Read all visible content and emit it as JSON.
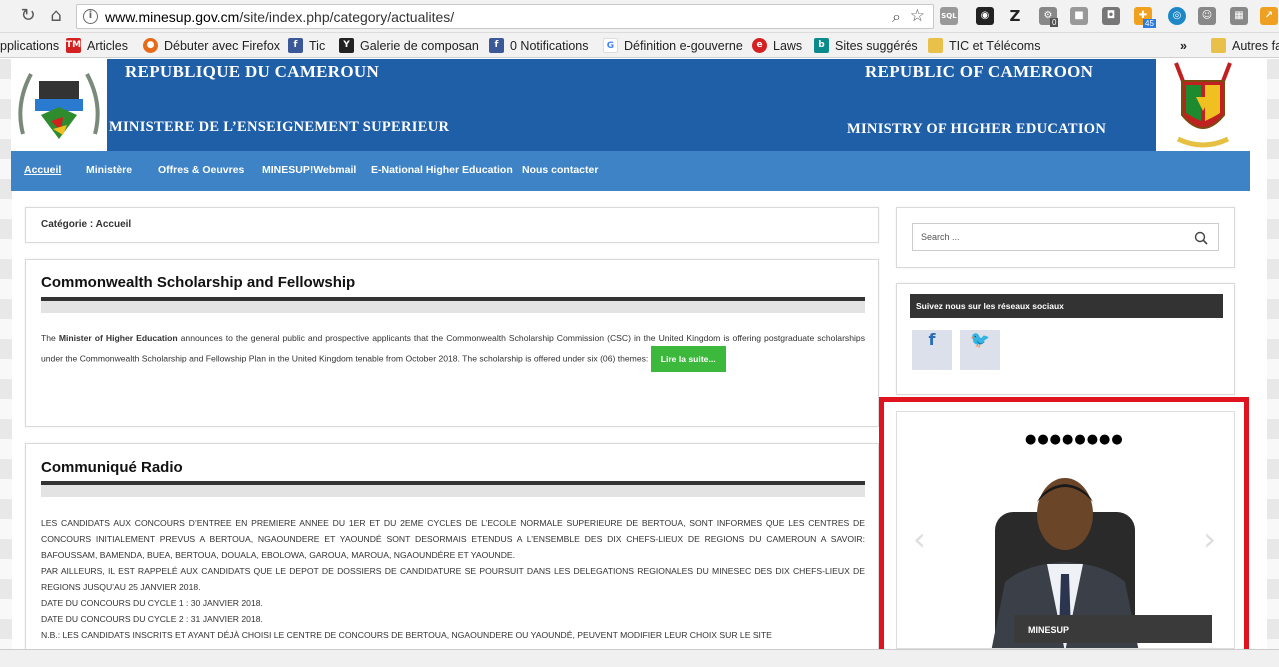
{
  "browser": {
    "url_prefix": "www.minesup.gov.cm",
    "url_path": "/site/index.php/category/actualites/",
    "bookmarks": [
      {
        "label": "pplications",
        "icon": "apps-icon",
        "color": "#4a78c2"
      },
      {
        "label": "Articles",
        "icon": "tm-icon",
        "color": "#d42020"
      },
      {
        "label": "Débuter avec Firefox",
        "icon": "firefox-icon",
        "color": "#e66a1a"
      },
      {
        "label": "Tic",
        "icon": "facebook-icon",
        "color": "#3b5998"
      },
      {
        "label": "Galerie de composan",
        "icon": "joomla-icon",
        "color": "#222"
      },
      {
        "label": "0 Notifications",
        "icon": "facebook-icon",
        "color": "#3b5998"
      },
      {
        "label": "Définition e-gouverne",
        "icon": "google-icon",
        "color": "#4285f4"
      },
      {
        "label": "Laws",
        "icon": "e-icon",
        "color": "#d42020"
      },
      {
        "label": "Sites suggérés",
        "icon": "bing-icon",
        "color": "#0a8a8a"
      },
      {
        "label": "TIC et Télécoms",
        "icon": "folder-icon",
        "color": "#e8c04a"
      },
      {
        "label": "»",
        "icon": "",
        "color": ""
      },
      {
        "label": "Autres fa",
        "icon": "folder-icon",
        "color": "#e8c04a"
      }
    ],
    "extension_badges": {
      "badge1": "0",
      "badge2": "45"
    }
  },
  "banner": {
    "fr_title": "REPUBLIQUE DU CAMEROUN",
    "fr_ministry": "MINISTERE DE L’ENSEIGNEMENT SUPERIEUR",
    "en_title": "REPUBLIC OF CAMEROON",
    "en_ministry": "MINISTRY OF HIGHER EDUCATION",
    "logo_left": "MINESUP"
  },
  "menu": [
    "Accueil",
    "Ministère",
    "Offres & Oeuvres",
    "MINESUP!Webmail",
    "E-National Higher Education",
    "Nous contacter"
  ],
  "breadcrumb": "Catégorie : Accueil",
  "posts": [
    {
      "title": "Commonwealth Scholarship and Fellowship",
      "text_pre": "The ",
      "text_bold": "Minister of Higher Education",
      "text_post": " announces to the general public and prospective applicants that the Commonwealth Scholarship Commission (CSC) in the United Kingdom is offering postgraduate scholarships under the Commonwealth Scholarship and Fellowship Plan in the United Kingdom tenable from October 2018. The scholarship is offered under six (06) themes: ",
      "read_more": "Lire la suite..."
    },
    {
      "title": "Communiqué Radio",
      "lines": [
        "LES CANDIDATS AUX CONCOURS D’ENTREE EN PREMIERE ANNEE DU 1ER ET DU 2EME CYCLES DE L’ECOLE NORMALE SUPERIEURE DE BERTOUA, SONT INFORMES QUE LES CENTRES DE CONCOURS INITIALEMENT PREVUS A BERTOUA, NGAOUNDERE ET YAOUNDÉ SONT DESORMAIS ETENDUS A L’ENSEMBLE DES DIX CHEFS-LIEUX DE REGIONS DU CAMEROUN A SAVOIR: BAFOUSSAM, BAMENDA, BUEA, BERTOUA, DOUALA, EBOLOWA, GAROUA, MAROUA, NGAOUNDÉRE ET YAOUNDE.",
        "PAR AILLEURS, IL EST RAPPELÉ AUX CANDIDATS QUE LE DEPOT DE DOSSIERS DE CANDIDATURE SE POURSUIT DANS LES DELEGATIONS REGIONALES DU MINESEC DES DIX CHEFS-LIEUX DE REGIONS JUSQU’AU 25 JANVIER 2018.",
        "DATE DU CONCOURS DU CYCLE 1 : 30 JANVIER 2018.",
        "DATE DU CONCOURS DU CYCLE 2 : 31 JANVIER 2018.",
        "N.B.: LES CANDIDATS INSCRITS ET AYANT DÉJÀ CHOISI LE CENTRE DE CONCOURS DE BERTOUA, NGAOUNDERE OU YAOUNDÉ, PEUVENT MODIFIER LEUR CHOIX SUR LE SITE"
      ]
    }
  ],
  "sidebar": {
    "search_placeholder": "Search ...",
    "social_heading": "Suivez nous sur les réseaux sociaux",
    "slider_caption": "MINESUP",
    "slider_dots": "●●●●●●●●"
  },
  "colors": {
    "banner": "#1f5fa8",
    "menubar": "#3e83c6",
    "read_more": "#3cb93c",
    "highlight": "#e0141e"
  }
}
